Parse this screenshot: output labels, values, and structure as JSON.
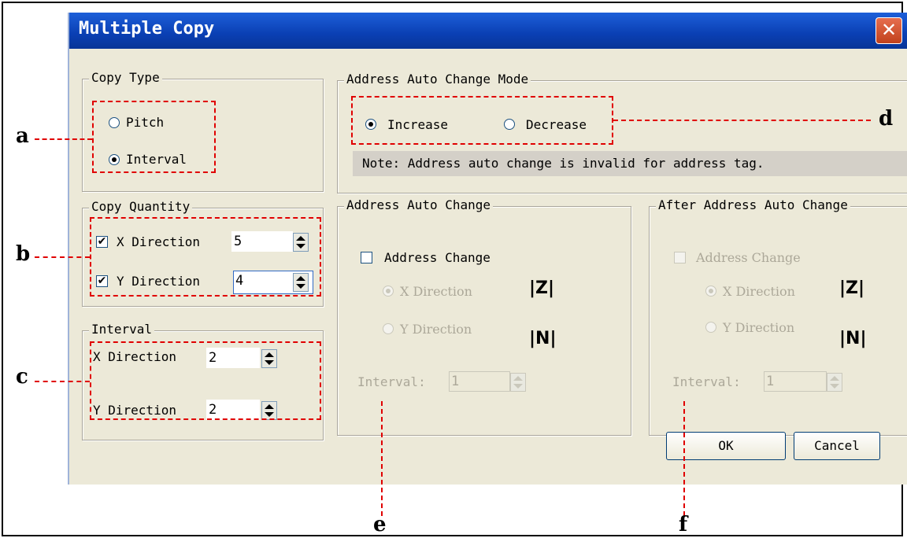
{
  "dialog": {
    "title": "Multiple Copy",
    "close_glyph": "✕",
    "copy_type": {
      "label": "Copy Type",
      "pitch": "Pitch",
      "interval": "Interval",
      "selected": "Interval"
    },
    "copy_quantity": {
      "label": "Copy Quantity",
      "x_label": "X Direction",
      "x_value": "5",
      "x_checked": true,
      "y_label": "Y Direction",
      "y_value": "4",
      "y_checked": true
    },
    "interval": {
      "label": "Interval",
      "x_label": "X Direction",
      "x_value": "2",
      "y_label": "Y Direction",
      "y_value": "2"
    },
    "mode": {
      "label": "Address Auto Change Mode",
      "increase": "Increase",
      "decrease": "Decrease",
      "selected": "Increase",
      "note": "Note: Address auto change is invalid for address tag."
    },
    "auto_change": {
      "label": "Address Auto Change",
      "address_change": "Address Change",
      "x_label": "X Direction",
      "y_label": "Y Direction",
      "interval_label": "Interval:",
      "interval_value": "1",
      "x_icon": "|Z|",
      "y_icon": "|N|"
    },
    "after_change": {
      "label": "After Address Auto Change",
      "address_change": "Address Change",
      "x_label": "X Direction",
      "y_label": "Y Direction",
      "interval_label": "Interval:",
      "interval_value": "1",
      "x_icon": "|Z|",
      "y_icon": "|N|"
    },
    "ok": "OK",
    "cancel": "Cancel"
  },
  "callouts": {
    "a": "a",
    "b": "b",
    "c": "c",
    "d": "d",
    "e": "e",
    "f": "f"
  },
  "colors": {
    "annotation": "#e00000",
    "titlebar": "#0a3fb3",
    "dialog_bg": "#ece9d8"
  },
  "icons": {
    "close": "close-icon",
    "spin": "spin-arrows-icon",
    "check": "check-icon",
    "z_order": "z-order-icon",
    "n_order": "n-order-icon"
  }
}
